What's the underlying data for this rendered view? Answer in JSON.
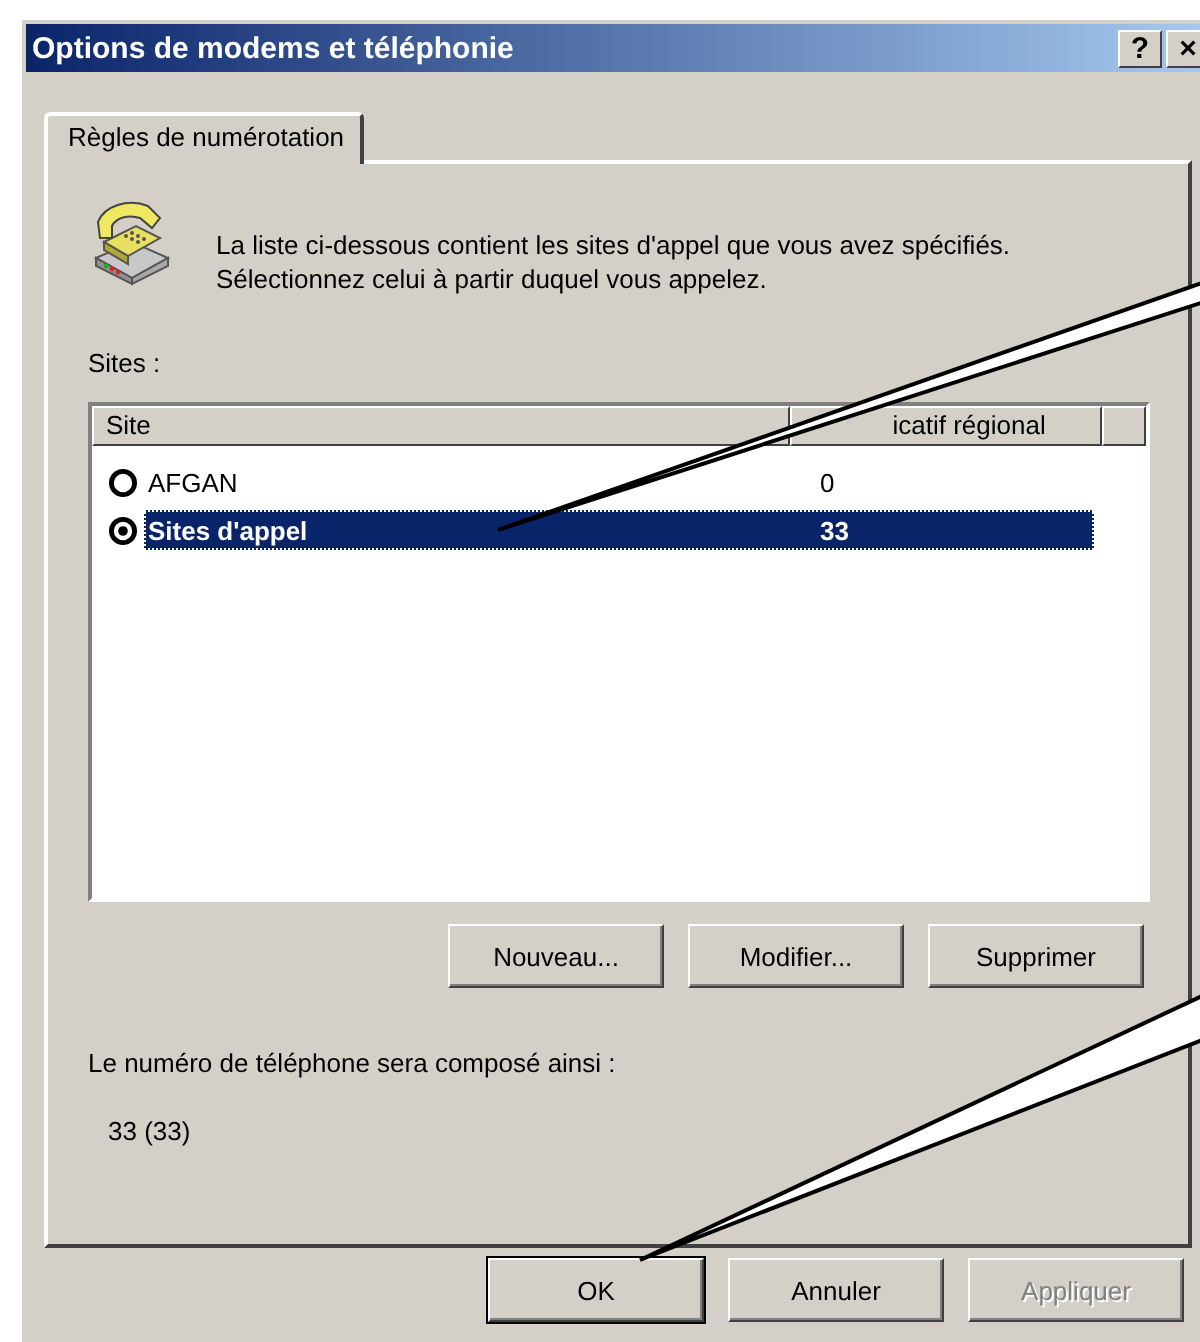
{
  "window": {
    "title": "Options de modems et téléphonie",
    "title_buttons": [
      "?",
      "×"
    ]
  },
  "tabs": [
    {
      "label": "Règles de numérotation",
      "selected": true
    }
  ],
  "intro": "La liste ci-dessous contient les sites d'appel que vous avez spécifiés. Sélectionnez celui à partir duquel vous appelez.",
  "sites_label": "Sites :",
  "table": {
    "columns": [
      "Site",
      "icatif régional"
    ],
    "rows": [
      {
        "site": "AFGAN",
        "code": "0",
        "selected": false
      },
      {
        "site": "Sites d'appel",
        "code": "33",
        "selected": true
      }
    ]
  },
  "list_buttons": [
    "Nouveau...",
    "Modifier...",
    "Supprimer"
  ],
  "dial_label": "Le numéro de téléphone sera composé ainsi :",
  "dial_value": "33 (33)",
  "buttons": [
    {
      "label": "OK",
      "default": true,
      "disabled": false
    },
    {
      "label": "Annuler",
      "default": false,
      "disabled": false
    },
    {
      "label": "Appliquer",
      "default": false,
      "disabled": true
    }
  ]
}
